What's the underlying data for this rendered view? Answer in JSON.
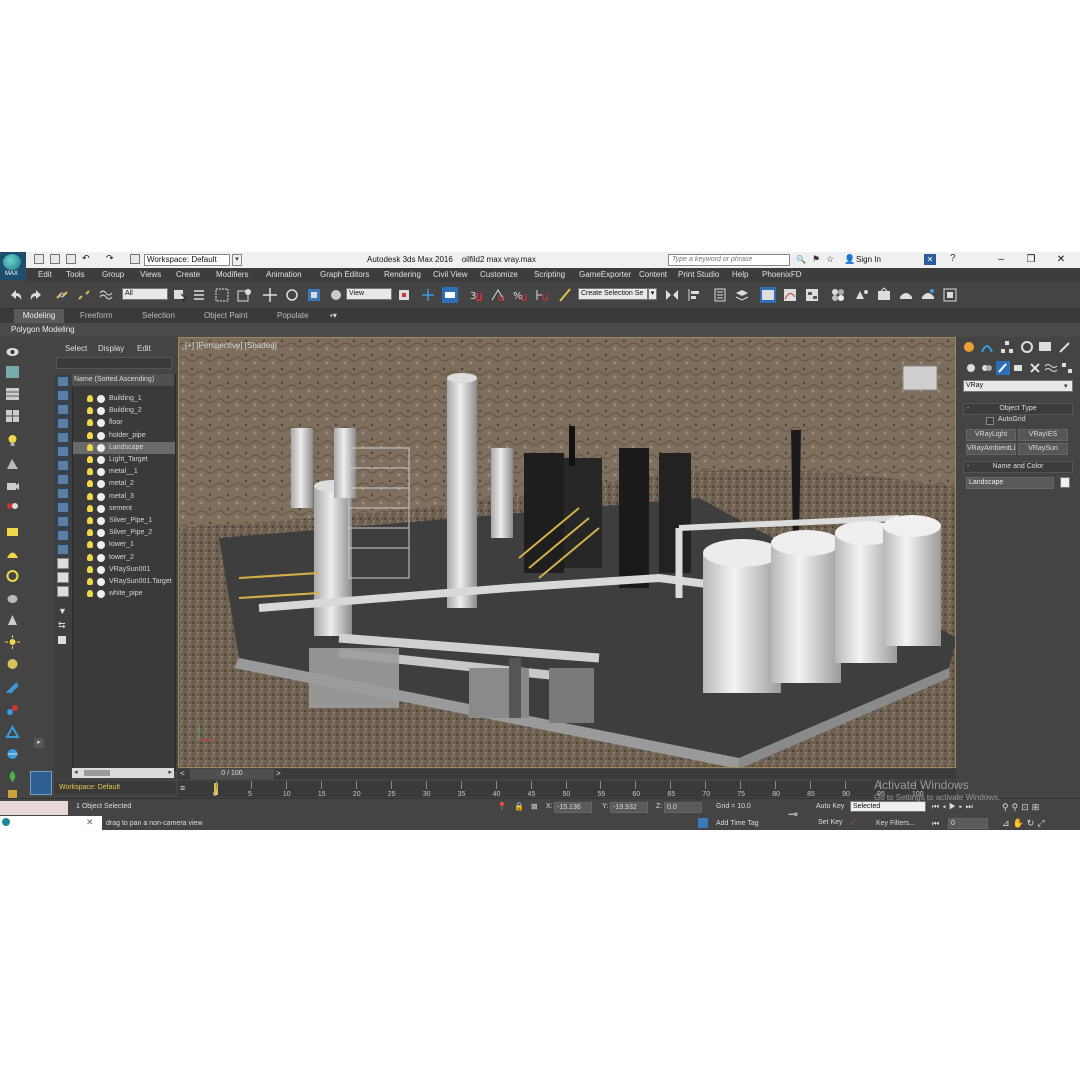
{
  "app": {
    "logo_text": "MAX",
    "title": "Autodesk 3ds Max 2016",
    "filename": "oilfild2 max vray.max",
    "workspace": "Workspace: Default",
    "search_placeholder": "Type a keyword or phrase",
    "sign_in": "Sign In"
  },
  "menu": [
    "Edit",
    "Tools",
    "Group",
    "Views",
    "Create",
    "Modifiers",
    "Animation",
    "Graph Editors",
    "Rendering",
    "Civil View",
    "Customize",
    "Scripting",
    "GameExporter",
    "Content",
    "Print Studio",
    "Help",
    "PhoenixFD"
  ],
  "toolbar": {
    "selection_filter": "All",
    "ref_coord": "View",
    "create_selection_set": "Create Selection Se"
  },
  "ribbon": {
    "tabs": [
      "Modeling",
      "Freeform",
      "Selection",
      "Object Paint",
      "Populate"
    ],
    "sub": "Polygon Modeling"
  },
  "explorer": {
    "menu": [
      "Select",
      "Display",
      "Edit"
    ],
    "column_header": "Name (Sorted Ascending)",
    "items": [
      "Building_1",
      "Building_2",
      "floor",
      "holder_pipe",
      "Landscape",
      "Light_Target",
      "metal__1",
      "metal_2",
      "metal_3",
      "sement",
      "Silver_Pipe_1",
      "Silver_Pipe_2",
      "tower_1",
      "tower_2",
      "VRaySun001",
      "VRaySun001.Target",
      "white_pipe"
    ],
    "selected_index": 4,
    "workspace_label": "Workspace: Default"
  },
  "viewport": {
    "label": "[+] [Perspective] [Shaded]"
  },
  "command_panel": {
    "renderer": "VRay",
    "object_type_header": "Object Type",
    "autogrid": "AutoGrid",
    "buttons": [
      "VRayLight",
      "VRayIES",
      "VRayAmbientLig",
      "VRaySun"
    ],
    "name_color_header": "Name and Color",
    "object_name": "Landscape"
  },
  "timeline": {
    "frame_display": "0 / 100",
    "ticks": [
      "0",
      "5",
      "10",
      "15",
      "20",
      "25",
      "30",
      "35",
      "40",
      "45",
      "50",
      "55",
      "60",
      "65",
      "70",
      "75",
      "80",
      "85",
      "90",
      "95",
      "100"
    ]
  },
  "status": {
    "selection_info": "1 Object Selected",
    "prompt": "drag to pan a non-camera view",
    "x_label": "X:",
    "x_value": "-15.136",
    "y_label": "Y:",
    "y_value": "-19.932",
    "z_label": "Z:",
    "z_value": "0.0",
    "grid": "Grid = 10.0",
    "add_time_tag": "Add Time Tag",
    "auto_key": "Auto Key",
    "set_key": "Set Key",
    "key_mode": "Selected",
    "key_filters": "Key Filters...",
    "frame": "0"
  },
  "watermark": {
    "line1": "Activate Windows",
    "line2": "Go to Settings to activate Windows."
  }
}
